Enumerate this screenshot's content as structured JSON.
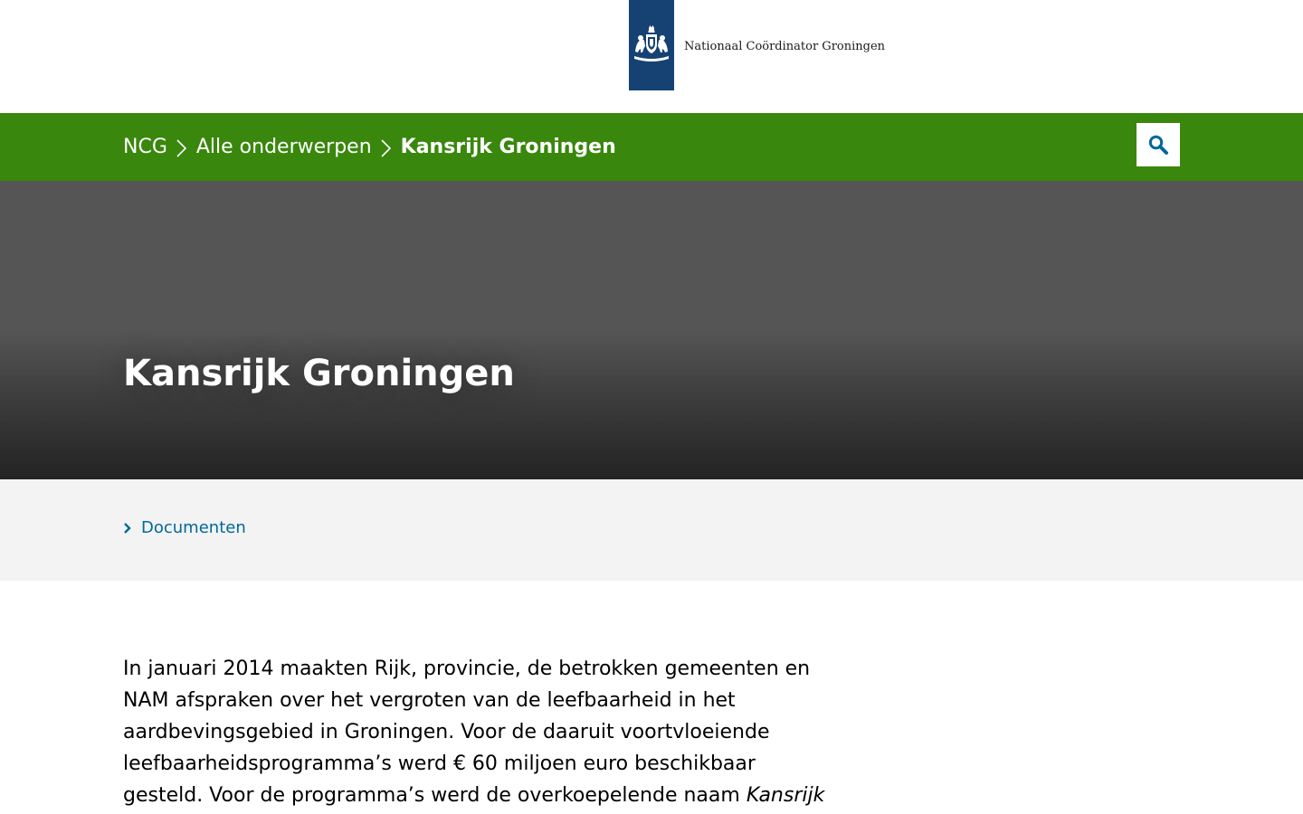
{
  "header": {
    "logo_text": "Nationaal Coördinator Groningen",
    "logo_color": "#154273"
  },
  "breadcrumb": {
    "items": [
      {
        "label": "NCG"
      },
      {
        "label": "Alle onderwerpen"
      },
      {
        "label": "Kansrijk Groningen"
      }
    ],
    "bar_color": "#39870c"
  },
  "search": {
    "icon": "search-icon",
    "icon_color": "#01689b"
  },
  "hero": {
    "title": "Kansrijk Groningen"
  },
  "subnav": {
    "link_label": "Documenten",
    "link_color": "#01689b"
  },
  "content": {
    "intro_part1": "In januari 2014 maakten Rijk, provincie, de betrokken gemeenten en NAM afspraken over het vergroten van de leefbaarheid in het aardbevingsgebied in Groningen. Voor de daaruit voortvloeiende leefbaarheidsprogramma’s werd € 60 miljoen euro beschikbaar gesteld. Voor de programma’s werd de overkoepelende naam ",
    "intro_emphasis": "Kansrijk Groningen"
  }
}
